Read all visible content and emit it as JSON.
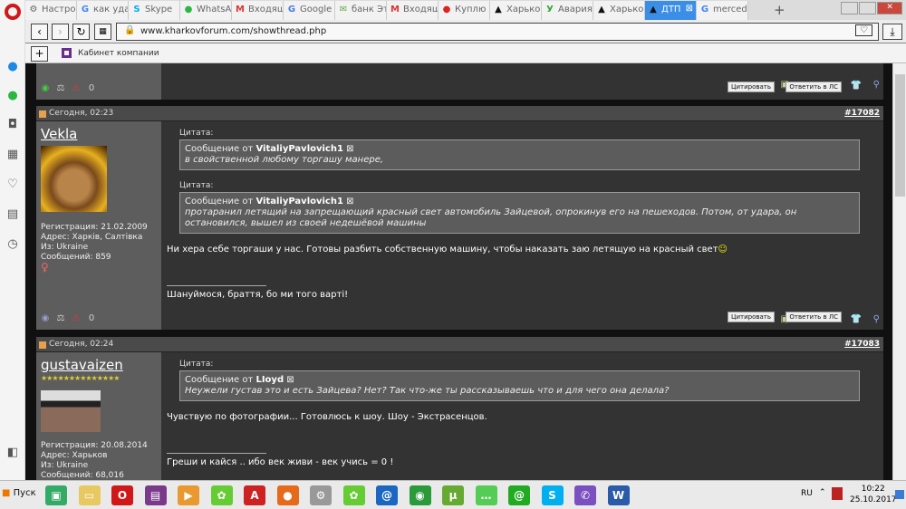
{
  "browser": {
    "tabs": [
      {
        "label": "Настрой",
        "icon": "gear-icon"
      },
      {
        "label": "как удал",
        "icon": "google-icon"
      },
      {
        "label": "Skype",
        "icon": "skype-icon"
      },
      {
        "label": "WhatsAp",
        "icon": "whatsapp-icon"
      },
      {
        "label": "Входящ",
        "icon": "gmail-icon"
      },
      {
        "label": "Google",
        "icon": "google-translate-icon"
      },
      {
        "label": "банк Эт",
        "icon": "mail-icon"
      },
      {
        "label": "Входящ",
        "icon": "gmail-icon"
      },
      {
        "label": "Куплю",
        "icon": "olx-icon"
      },
      {
        "label": "Харьков",
        "icon": "kharkov-icon"
      },
      {
        "label": "Авария",
        "icon": "ua-icon"
      },
      {
        "label": "Харьков",
        "icon": "kharkov-icon"
      },
      {
        "label": "ДТП",
        "icon": "kharkov-icon",
        "active": true
      },
      {
        "label": "merced",
        "icon": "google-icon"
      }
    ],
    "new_tab": "+",
    "url": "www.kharkovforum.com/showthread.php",
    "bookmark": "Кабинет компании",
    "bookmark_add": "+"
  },
  "forum": {
    "quote_btn": "Цитировать",
    "reply_pm_btn": "Ответить в ЛС",
    "quote_label": "Цитата:",
    "msg_from": "Сообщение от",
    "top_post": {
      "count": "0"
    },
    "posts": [
      {
        "time": "Сегодня, 02:23",
        "number": "#17082",
        "user": "Vekla",
        "reg": "Регистрация: 21.02.2009",
        "addr": "Адрес: Харків, Салтівка",
        "from": "Из: Ukraine",
        "msgs": "Сообщений: 859",
        "count": "0",
        "quotes": [
          {
            "author": "VitaliyPavlovich1",
            "text": "в свойственной любому торгашу манере,"
          },
          {
            "author": "VitaliyPavlovich1",
            "text": "протаранил летящий на запрещающий красный свет автомобиль Зайцевой, опрокинув его на пешеходов. Потом, от удара, он остановился, вышел из своей недешёвой машины"
          }
        ],
        "text": "Ни хера себе торгаши у нас. Готовы разбить собственную машину, чтобы наказать заю летящую на красный свет",
        "signature": "Шануймося, браття, бо ми того варті!"
      },
      {
        "time": "Сегодня, 02:24",
        "number": "#17083",
        "user": "gustavaizen",
        "stars": "★★★★★★★★★★★★★★",
        "reg": "Регистрация: 20.08.2014",
        "addr": "Адрес: Харьков",
        "from": "Из: Ukraine",
        "msgs": "Сообщений: 68,016",
        "quotes": [
          {
            "author": "LIoyd",
            "text": "Неужели густав это и есть Зайцева? Нет? Так что-же ты рассказываешь что и для чего она делала?"
          }
        ],
        "text": "Чувствую по фотографии... Готовлюсь к шоу. Шоу - Экстрасенцов.",
        "signature": "Греши и кайся .. ибо век живи - век учись = 0 !"
      }
    ]
  },
  "taskbar": {
    "start": "Пуск",
    "lang": "RU",
    "time": "10:22",
    "date": "25.10.2017"
  }
}
